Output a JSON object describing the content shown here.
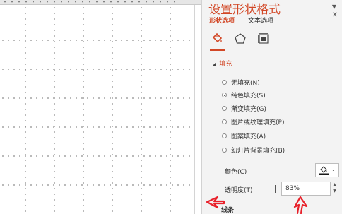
{
  "pane": {
    "title": "设置形状格式",
    "tabs": [
      {
        "label": "形状选项",
        "active": true
      },
      {
        "label": "文本选项",
        "active": false
      }
    ],
    "icons": [
      "fill-line-icon",
      "effects-pentagon-icon",
      "size-properties-icon"
    ]
  },
  "fill": {
    "section_title": "填充",
    "options": [
      {
        "label": "无填充(N)",
        "selected": false
      },
      {
        "label": "纯色填充(S)",
        "selected": true
      },
      {
        "label": "渐变填充(G)",
        "selected": false
      },
      {
        "label": "图片或纹理填充(P)",
        "selected": false
      },
      {
        "label": "图案填充(A)",
        "selected": false
      },
      {
        "label": "幻灯片背景填充(B)",
        "selected": false
      }
    ],
    "color_label": "颜色(C)",
    "transparency_label": "透明度(T)",
    "transparency_value": "83%",
    "transparency_level": 0.83
  },
  "line": {
    "section_title": "线条"
  },
  "colors": {
    "accent": "#d24726",
    "annotation": "#e8202a",
    "pane_bg": "#f3f3f3"
  }
}
